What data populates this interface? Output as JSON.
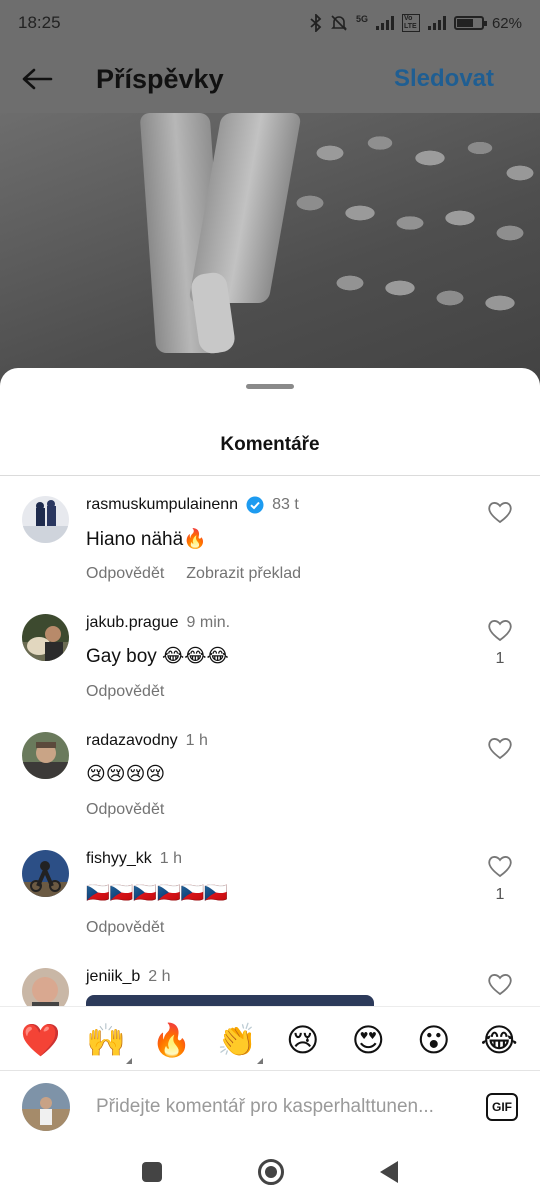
{
  "status_bar": {
    "time": "18:25",
    "network_label": "5G",
    "volte_label": "Vo LTE",
    "battery_percent": "62%"
  },
  "nav": {
    "title": "Příspěvky",
    "follow_label": "Sledovat"
  },
  "sheet": {
    "title": "Komentáře"
  },
  "comments": [
    {
      "username": "rasmuskumpulainenn",
      "verified": true,
      "time": "83 t",
      "text": "Hiano nähä🔥",
      "actions": [
        "Odpovědět",
        "Zobrazit překlad"
      ],
      "likes": ""
    },
    {
      "username": "jakub.prague",
      "verified": false,
      "time": "9 min.",
      "text": "Gay boy 😂😂😂",
      "actions": [
        "Odpovědět"
      ],
      "likes": "1"
    },
    {
      "username": "radazavodny",
      "verified": false,
      "time": "1 h",
      "text": "😢😢😢😢",
      "actions": [
        "Odpovědět"
      ],
      "likes": ""
    },
    {
      "username": "fishyy_kk",
      "verified": false,
      "time": "1 h",
      "text": "🇨🇿🇨🇿🇨🇿🇨🇿🇨🇿🇨🇿",
      "actions": [
        "Odpovědět"
      ],
      "likes": "1"
    },
    {
      "username": "jeniik_b",
      "verified": false,
      "time": "2 h",
      "text": "",
      "actions": [],
      "likes": ""
    }
  ],
  "reactions": [
    "❤️",
    "🙌",
    "🔥",
    "👏",
    "😢",
    "😍",
    "😮",
    "😂"
  ],
  "composer": {
    "placeholder": "Přidejte komentář pro kasperhalttunen...",
    "gif_label": "GIF"
  }
}
